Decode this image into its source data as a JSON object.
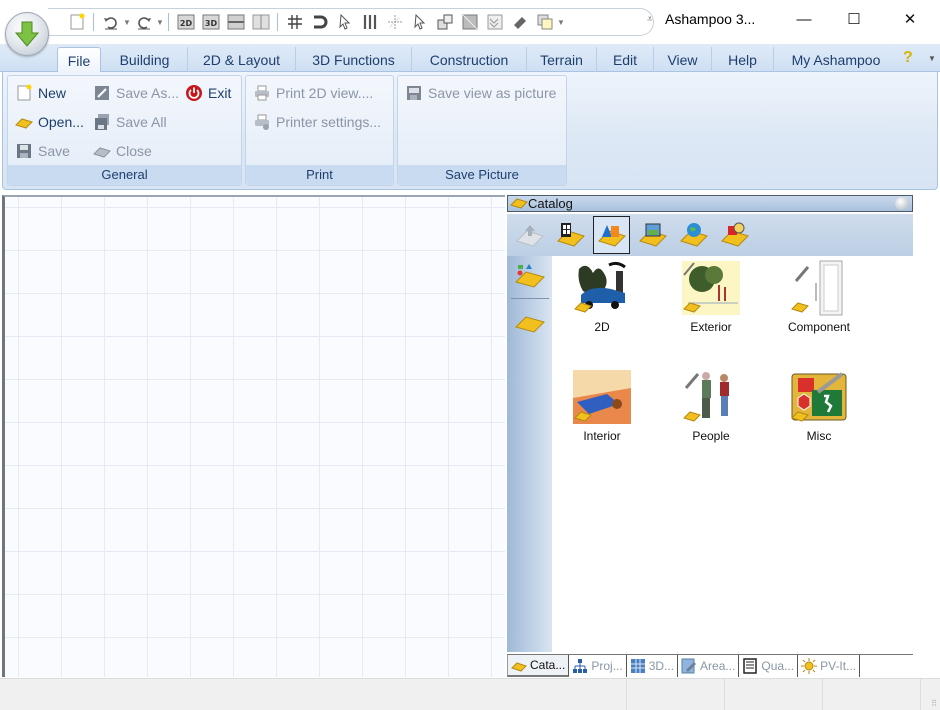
{
  "window": {
    "title": "Ashampoo 3...",
    "controls": {
      "minimize": "—",
      "maximize": "☐",
      "close": "✕"
    }
  },
  "quick_access": {
    "items": [
      "new-document",
      "undo",
      "redo",
      "2d-view",
      "3d-view",
      "horizontal-split",
      "vertical-split",
      "grid",
      "snap-magnet",
      "select-cursor",
      "columns",
      "crosshair",
      "pointer",
      "window-swap",
      "tile",
      "tile-alt",
      "eraser",
      "copy-layers"
    ],
    "labels": {
      "2d": "2D",
      "3d": "3D"
    },
    "customize": "⩡"
  },
  "ribbon": {
    "tabs": [
      "File",
      "Building",
      "2D & Layout",
      "3D Functions",
      "Construction",
      "Terrain",
      "Edit",
      "View",
      "Help",
      "My Ashampoo"
    ],
    "active_tab": "File",
    "help_icon": "?",
    "groups": [
      {
        "label": "General",
        "buttons": [
          {
            "label": "New",
            "icon": "new-file-icon",
            "enabled": true
          },
          {
            "label": "Open...",
            "icon": "open-folder-icon",
            "enabled": true
          },
          {
            "label": "Save",
            "icon": "floppy-icon",
            "enabled": false
          },
          {
            "label": "Save As...",
            "icon": "save-as-icon",
            "enabled": false
          },
          {
            "label": "Save All",
            "icon": "save-all-icon",
            "enabled": false
          },
          {
            "label": "Close",
            "icon": "close-folder-icon",
            "enabled": false
          },
          {
            "label": "Exit",
            "icon": "power-icon",
            "enabled": true
          }
        ]
      },
      {
        "label": "Print",
        "buttons": [
          {
            "label": "Print 2D view....",
            "icon": "printer-icon",
            "enabled": false
          },
          {
            "label": "Printer settings...",
            "icon": "printer-settings-icon",
            "enabled": false
          }
        ]
      },
      {
        "label": "Save Picture",
        "buttons": [
          {
            "label": "Save view as picture",
            "icon": "save-picture-icon",
            "enabled": false
          }
        ]
      }
    ]
  },
  "catalog": {
    "title": "Catalog",
    "toolbar": [
      "up-level",
      "windows-doors",
      "3d-objects",
      "textures",
      "globe",
      "materials"
    ],
    "selected_tool": "3d-objects",
    "side_buttons": [
      "symbols-folder",
      "folder"
    ],
    "items": [
      {
        "label": "2D"
      },
      {
        "label": "Exterior"
      },
      {
        "label": "Component"
      },
      {
        "label": "Interior"
      },
      {
        "label": "People"
      },
      {
        "label": "Misc"
      }
    ]
  },
  "panel_tabs": [
    {
      "label": "Cata...",
      "icon": "catalog-icon",
      "active": true
    },
    {
      "label": "Proj...",
      "icon": "project-tree-icon",
      "active": false
    },
    {
      "label": "3D...",
      "icon": "grid-3d-icon",
      "active": false
    },
    {
      "label": "Area...",
      "icon": "area-icon",
      "active": false
    },
    {
      "label": "Qua...",
      "icon": "quantities-icon",
      "active": false
    },
    {
      "label": "PV-It...",
      "icon": "sun-icon",
      "active": false
    }
  ],
  "status_bar": {
    "cells": [
      "",
      "",
      "",
      "",
      ""
    ]
  }
}
